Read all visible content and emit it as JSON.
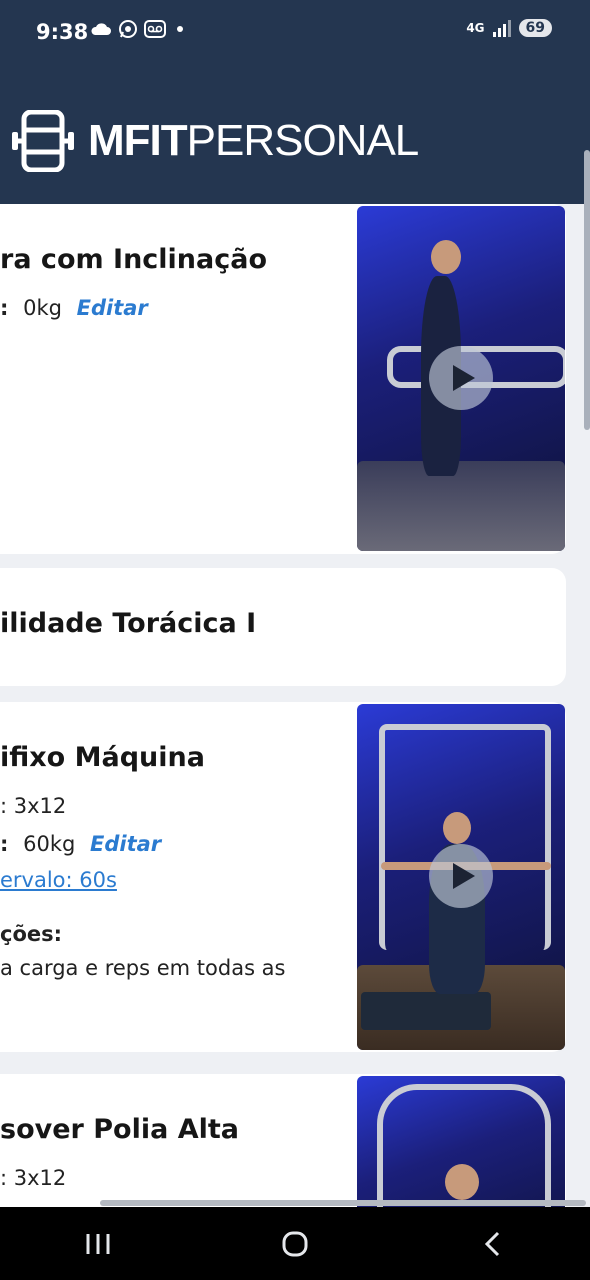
{
  "status_bar": {
    "time": "9:38",
    "network": "4G",
    "battery": "69"
  },
  "header": {
    "brand_bold": "MFIT",
    "brand_light": "PERSONAL"
  },
  "exercises": [
    {
      "title": "ra com Inclinação",
      "carga_prefix": ":",
      "carga_value": "0kg",
      "edit_label": "Editar"
    },
    {
      "title": "ilidade Torácica I"
    },
    {
      "title": "ifixo Máquina",
      "series": ": 3x12",
      "carga_prefix": ":",
      "carga_value": "60kg",
      "edit_label": "Editar",
      "interval": "ervalo: 60s",
      "notes_label": "ções:",
      "notes_text": "a carga e reps em todas as"
    },
    {
      "title": "sover Polia Alta",
      "series": ": 3x12"
    }
  ],
  "colors": {
    "header_bg": "#243650",
    "accent": "#2b7bd0"
  }
}
